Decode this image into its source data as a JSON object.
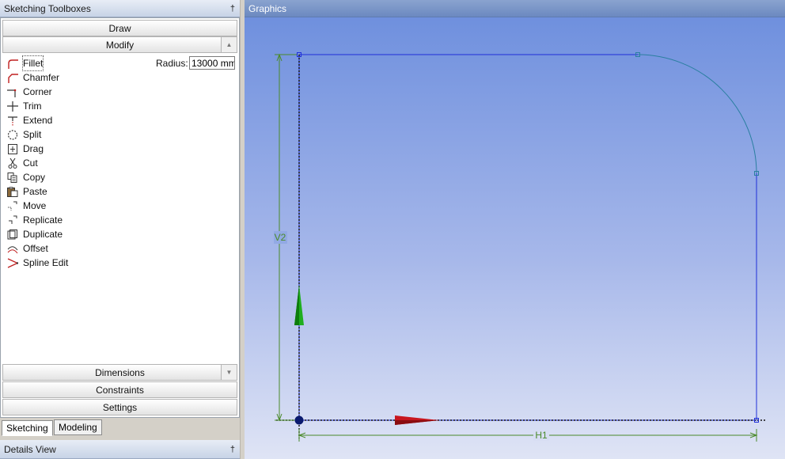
{
  "left_panel": {
    "title": "Sketching Toolboxes",
    "pin": "†"
  },
  "sections": {
    "draw": "Draw",
    "modify": "Modify",
    "dimensions": "Dimensions",
    "constraints": "Constraints",
    "settings": "Settings"
  },
  "tools": [
    {
      "label": "Fillet",
      "icon": "fillet-icon"
    },
    {
      "label": "Chamfer",
      "icon": "chamfer-icon"
    },
    {
      "label": "Corner",
      "icon": "corner-icon"
    },
    {
      "label": "Trim",
      "icon": "trim-icon"
    },
    {
      "label": "Extend",
      "icon": "extend-icon"
    },
    {
      "label": "Split",
      "icon": "split-icon"
    },
    {
      "label": "Drag",
      "icon": "drag-icon"
    },
    {
      "label": "Cut",
      "icon": "scissors-icon"
    },
    {
      "label": "Copy",
      "icon": "copy-icon"
    },
    {
      "label": "Paste",
      "icon": "paste-icon"
    },
    {
      "label": "Move",
      "icon": "move-icon"
    },
    {
      "label": "Replicate",
      "icon": "replicate-icon"
    },
    {
      "label": "Duplicate",
      "icon": "duplicate-icon"
    },
    {
      "label": "Offset",
      "icon": "offset-icon"
    },
    {
      "label": "Spline Edit",
      "icon": "spline-edit-icon"
    }
  ],
  "fillet_options": {
    "radius_label": "Radius:",
    "radius_value": "13000 mm"
  },
  "tabs": {
    "sketching": "Sketching",
    "modeling": "Modeling",
    "active": "Sketching"
  },
  "details": {
    "title": "Details View",
    "pin": "†"
  },
  "graphics": {
    "title": "Graphics",
    "dim_vertical": "V2",
    "dim_horizontal": "H1"
  },
  "colors": {
    "sketch_line": "#1f2fd8",
    "arc": "#2a7fa0",
    "dimension": "#4a8a2a",
    "axis_x": "#c8161e",
    "axis_y": "#1fae1f"
  }
}
